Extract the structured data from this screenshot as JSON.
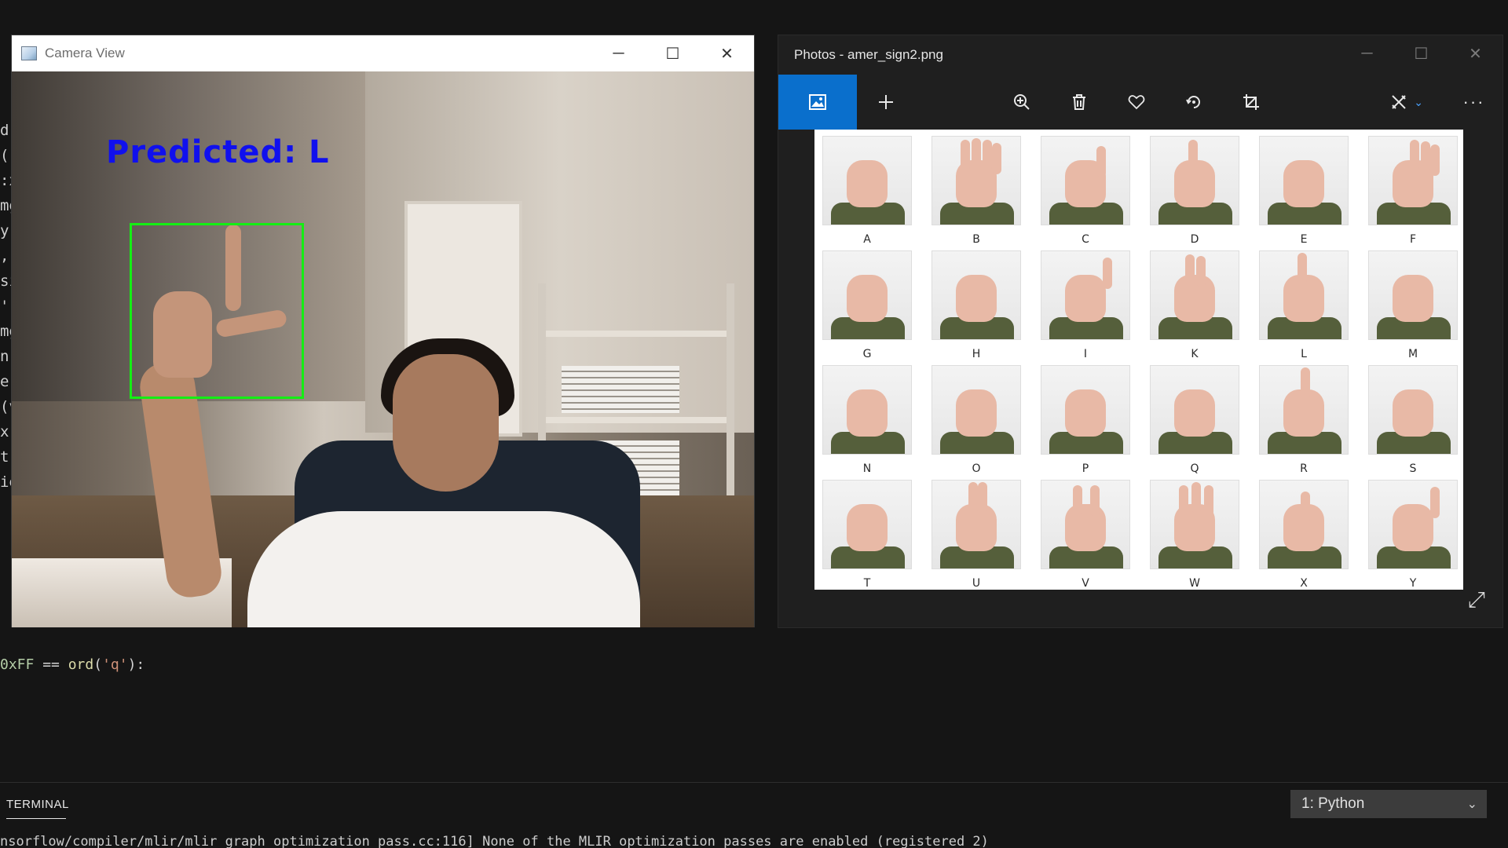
{
  "editor_strip": [
    "d(",
    "(",
    ":x",
    "",
    "mg",
    "y(",
    ",",
    "si",
    "",
    "",
    "')",
    "mg",
    "n(",
    "",
    "e",
    "(v",
    "x(",
    "",
    "tr",
    "ie"
  ],
  "camera_window": {
    "title": "Camera View",
    "prediction_text": "Predicted: L",
    "controls": {
      "minimize": "─",
      "maximize": "☐",
      "close": "✕"
    }
  },
  "photos_window": {
    "title": "Photos - amer_sign2.png",
    "controls": {
      "minimize": "─",
      "maximize": "☐",
      "close": "✕"
    },
    "toolbar": {
      "view_icon": "image-icon",
      "add_icon": "plus-icon",
      "zoom_icon": "zoom-in-icon",
      "delete_icon": "trash-icon",
      "favorite_icon": "heart-icon",
      "rotate_icon": "rotate-icon",
      "crop_icon": "crop-icon",
      "edit_icon": "edit-create-icon",
      "more_icon": "more-icon"
    },
    "signs": [
      "A",
      "B",
      "C",
      "D",
      "E",
      "F",
      "G",
      "H",
      "I",
      "K",
      "L",
      "M",
      "N",
      "O",
      "P",
      "Q",
      "R",
      "S",
      "T",
      "U",
      "V",
      "W",
      "X",
      "Y"
    ],
    "expand_icon": "expand-icon"
  },
  "editor": {
    "code_line": {
      "hex": "0xFF",
      "op": " == ",
      "fn": "ord",
      "open": "(",
      "str": "'q'",
      "close": "):"
    }
  },
  "terminal": {
    "tab_label": "TERMINAL",
    "shell_select": "1: Python",
    "output_line": "nsorflow/compiler/mlir/mlir_graph_optimization_pass.cc:116] None of the MLIR optimization passes are enabled (registered 2)"
  },
  "colors": {
    "accent": "#0a6fcc",
    "prediction": "#1010ee",
    "roi_box": "#14ee14"
  }
}
